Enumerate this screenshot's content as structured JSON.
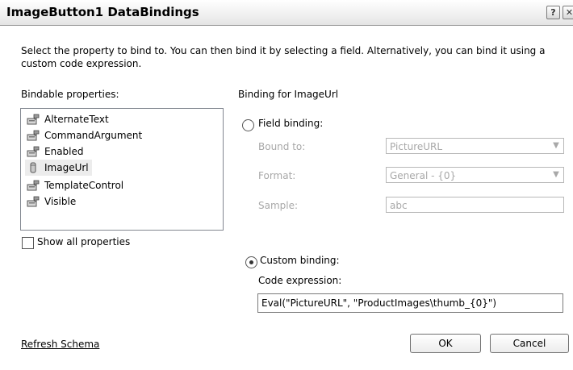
{
  "window": {
    "title": "ImageButton1 DataBindings",
    "help_label": "?",
    "close_label": "✕"
  },
  "intro_text": "Select the property to bind to. You can then bind it by selecting a field. Alternatively, you can bind it using a custom code expression.",
  "bindable": {
    "label": "Bindable properties:",
    "items": [
      {
        "label": "AlternateText",
        "icon": "property-icon"
      },
      {
        "label": "CommandArgument",
        "icon": "property-icon"
      },
      {
        "label": "Enabled",
        "icon": "property-icon"
      },
      {
        "label": "ImageUrl",
        "icon": "bound-field-icon",
        "selected": true
      },
      {
        "label": "TemplateControl",
        "icon": "property-icon"
      },
      {
        "label": "Visible",
        "icon": "property-icon"
      }
    ],
    "show_all_label": "Show all properties",
    "show_all_checked": false
  },
  "binding": {
    "header": "Binding for ImageUrl",
    "field_binding_label": "Field binding:",
    "field_binding_selected": false,
    "bound_to_label": "Bound to:",
    "bound_to_value": "PictureURL",
    "format_label": "Format:",
    "format_value": "General - {0}",
    "sample_label": "Sample:",
    "sample_value": "abc",
    "custom_binding_label": "Custom binding:",
    "custom_binding_selected": true,
    "code_expression_label": "Code expression:",
    "code_expression_value": "Eval(\"PictureURL\", \"ProductImages\\thumb_{0}\")"
  },
  "footer": {
    "refresh_label": "Refresh Schema",
    "ok_label": "OK",
    "cancel_label": "Cancel"
  },
  "colors": {
    "disabled_text": "#a8a8a8",
    "selection": "#ececec"
  }
}
